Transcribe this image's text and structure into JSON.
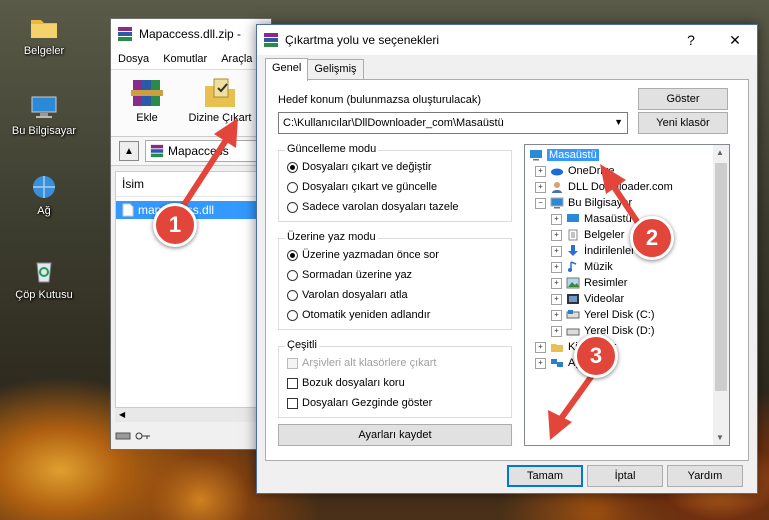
{
  "desktop": {
    "icons": [
      {
        "label": "Belgeler",
        "icon": "folder-icon"
      },
      {
        "label": "Bu Bilgisayar",
        "icon": "computer-icon"
      },
      {
        "label": "Ağ",
        "icon": "network-icon"
      },
      {
        "label": "Çöp Kutusu",
        "icon": "recycle-bin-icon"
      }
    ]
  },
  "archive_window": {
    "title": "Mapaccess.dll.zip -",
    "menu": [
      "Dosya",
      "Komutlar",
      "Araçla"
    ],
    "toolbar": {
      "add_label": "Ekle",
      "extract_label": "Dizine Çıkart"
    },
    "address": "Mapaccess",
    "column_name": "İsim",
    "file_name": "mapaccess.dll"
  },
  "dialog": {
    "title": "Çıkartma yolu ve seçenekleri",
    "help_button": "?",
    "close_button": "✕",
    "tabs": [
      "Genel",
      "Gelişmiş"
    ],
    "destination_label": "Hedef konum (bulunmazsa oluşturulacak)",
    "destination_value": "C:\\Kullanıcılar\\DllDownloader_com\\Masaüstü",
    "show_button": "Göster",
    "new_folder_button": "Yeni klasör",
    "update_mode": {
      "title": "Güncelleme modu",
      "options": [
        "Dosyaları çıkart ve değiştir",
        "Dosyaları çıkart ve güncelle",
        "Sadece varolan dosyaları tazele"
      ],
      "selected": 0
    },
    "overwrite_mode": {
      "title": "Üzerine yaz modu",
      "options": [
        "Üzerine yazmadan önce sor",
        "Sormadan üzerine yaz",
        "Varolan dosyaları atla",
        "Otomatik yeniden adlandır"
      ],
      "selected": 0
    },
    "misc": {
      "title": "Çeşitli",
      "options": [
        "Arşivleri alt klasörlere çıkart",
        "Bozuk dosyaları koru",
        "Dosyaları Gezginde göster"
      ]
    },
    "save_settings_button": "Ayarları kaydet",
    "tree": [
      {
        "label": "Masaüstü",
        "level": 0,
        "icon": "desktop-icon",
        "selected": true
      },
      {
        "label": "OneDrive",
        "level": 1,
        "icon": "cloud-icon"
      },
      {
        "label": "DLL Downloader.com",
        "level": 1,
        "icon": "user-icon"
      },
      {
        "label": "Bu Bilgisayar",
        "level": 1,
        "icon": "computer-icon",
        "expanded": true
      },
      {
        "label": "Masaüstü",
        "level": 2,
        "icon": "desktop-icon"
      },
      {
        "label": "Belgeler",
        "level": 2,
        "icon": "documents-icon"
      },
      {
        "label": "İndirilenler",
        "level": 2,
        "icon": "download-icon"
      },
      {
        "label": "Müzik",
        "level": 2,
        "icon": "music-icon"
      },
      {
        "label": "Resimler",
        "level": 2,
        "icon": "pictures-icon"
      },
      {
        "label": "Videolar",
        "level": 2,
        "icon": "video-icon"
      },
      {
        "label": "Yerel Disk (C:)",
        "level": 2,
        "icon": "disk-icon"
      },
      {
        "label": "Yerel Disk (D:)",
        "level": 2,
        "icon": "disk-icon"
      },
      {
        "label": "Kitaplıklar",
        "level": 1,
        "icon": "library-icon"
      },
      {
        "label": "Ağ",
        "level": 1,
        "icon": "network-icon"
      }
    ],
    "ok_button": "Tamam",
    "cancel_button": "İptal",
    "help_label": "Yardım"
  },
  "annotations": [
    "1",
    "2",
    "3"
  ],
  "colors": {
    "selection": "#3399ff",
    "annotation": "#e2453a"
  }
}
